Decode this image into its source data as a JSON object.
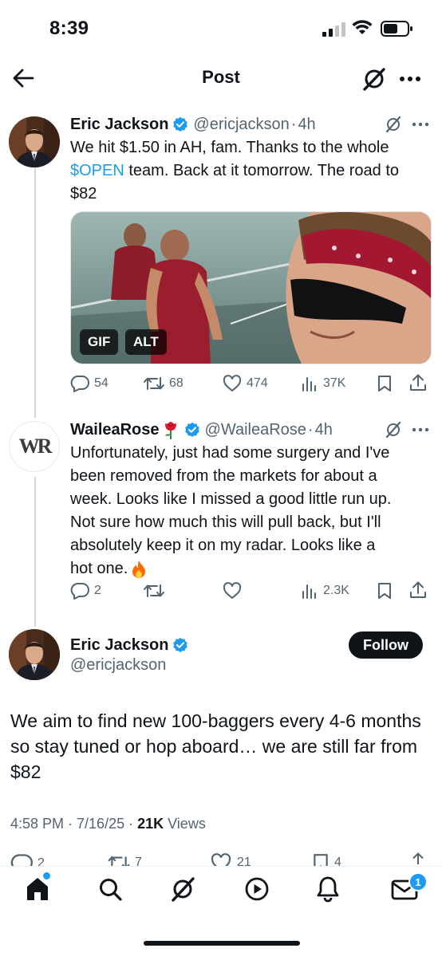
{
  "status_bar": {
    "time": "8:39"
  },
  "header": {
    "title": "Post"
  },
  "colors": {
    "accent": "#1d9bf0",
    "text": "#0f1419",
    "secondary": "#536471",
    "verified": "#1d9bf0",
    "fire": "#ff6a00"
  },
  "thread": [
    {
      "author": "Eric Jackson",
      "handle": "@ericjackson",
      "time": "4h",
      "text_line1": "We hit $1.50 in AH, fam. Thanks to the whole",
      "cashtag": "$OPEN",
      "text_line2_rest": " team. Back at it tomorrow. The road to",
      "text_line3": "$82",
      "media": {
        "badge_gif": "GIF",
        "badge_alt": "ALT"
      },
      "stats": {
        "replies": "54",
        "reposts": "68",
        "likes": "474",
        "views": "37K"
      }
    },
    {
      "author": "WaileaRose",
      "handle": "@WaileaRose",
      "time": "4h",
      "avatar_initials": "WR",
      "lines": [
        "Unfortunately, just had some surgery and I've",
        "been removed from the markets for about a",
        "week. Looks like I missed a good little run up.",
        "Not sure how much this will pull back, but I'll",
        "absolutely keep it on my radar. Looks like a",
        "hot one."
      ],
      "stats": {
        "replies": "2",
        "reposts": "",
        "likes": "",
        "views": "2.3K"
      }
    }
  ],
  "main_post": {
    "author": "Eric Jackson",
    "handle": "@ericjackson",
    "follow_label": "Follow",
    "text": "We aim to find new 100-baggers every 4-6 months so stay tuned or hop aboard… we are still far from $82",
    "time": "4:58 PM · 7/16/25 · ",
    "views_count": "21K",
    "views_label": " Views",
    "stats_partial": {
      "replies": "2",
      "reposts": "7",
      "likes": "21",
      "bookmarks": "4"
    }
  },
  "tabbar": {
    "items": [
      "home",
      "search",
      "grok",
      "video",
      "notifications",
      "messages"
    ],
    "messages_badge": "1"
  },
  "icons": [
    "back-arrow-icon",
    "grok-icon",
    "more-icon",
    "verified-icon",
    "reply-icon",
    "repost-icon",
    "like-icon",
    "views-icon",
    "bookmark-icon",
    "share-icon",
    "rose-emoji-icon",
    "fire-emoji-icon"
  ]
}
